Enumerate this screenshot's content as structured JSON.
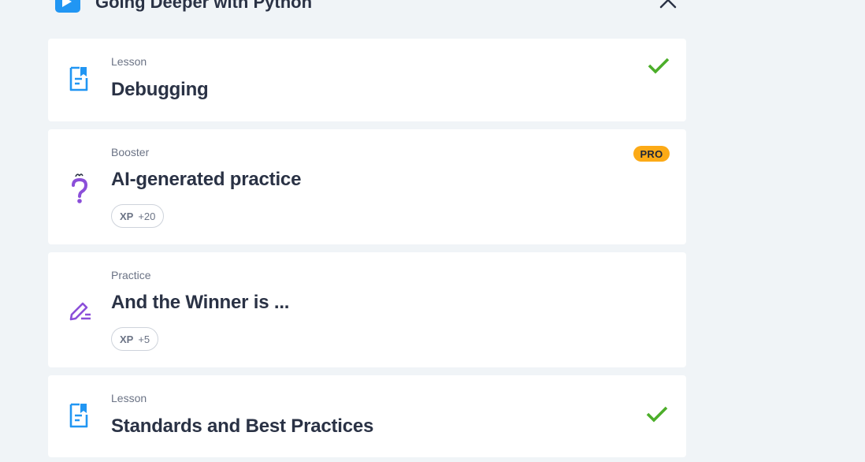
{
  "header": {
    "title": "Going Deeper with Python",
    "play_icon": "play-icon",
    "close_icon": "close-icon"
  },
  "items": [
    {
      "type": "Lesson",
      "title": "Debugging",
      "icon": "lesson-document-icon",
      "completed": true
    },
    {
      "type": "Booster",
      "title": "AI-generated practice",
      "icon": "question-mark-icon",
      "badge": "PRO",
      "xp_label": "XP",
      "xp_value": "+20"
    },
    {
      "type": "Practice",
      "title": "And the Winner is ...",
      "icon": "pencil-icon",
      "xp_label": "XP",
      "xp_value": "+5"
    },
    {
      "type": "Lesson",
      "title": "Standards and Best Practices",
      "icon": "lesson-document-icon",
      "completed": true
    }
  ],
  "colors": {
    "background": "#f0f4f7",
    "card": "#ffffff",
    "lesson_icon": "#2196f3",
    "booster_icon": "#8b4fd9",
    "check": "#4cae2a",
    "pro_badge": "#fcaa16",
    "title_text": "#2a3245",
    "muted_text": "#6b7385"
  }
}
